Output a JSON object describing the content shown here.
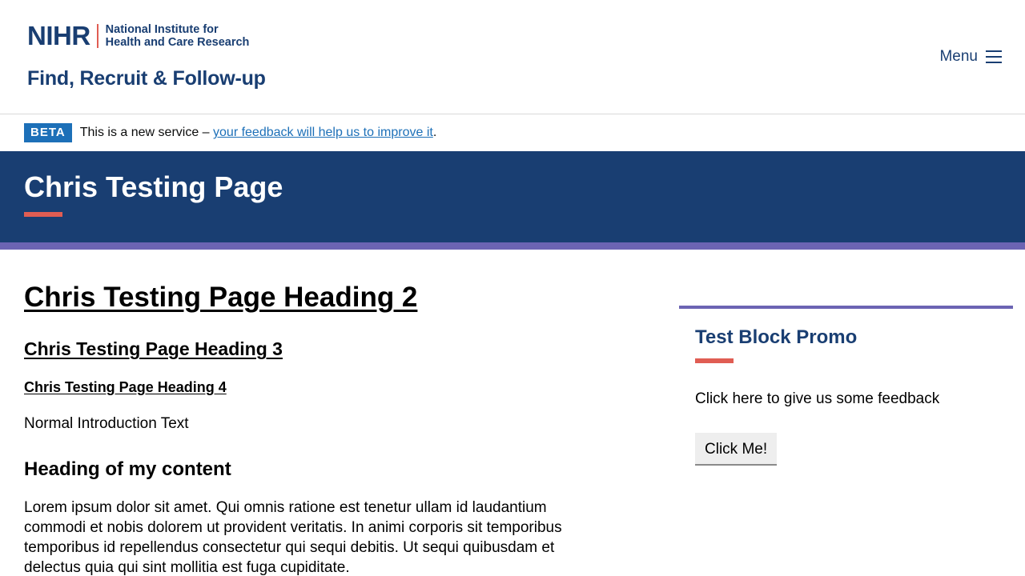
{
  "header": {
    "logo_mark": "NIHR",
    "logo_line1": "National Institute for",
    "logo_line2": "Health and Care Research",
    "service_name": "Find, Recruit & Follow-up",
    "menu_label": "Menu",
    "menu_icon": "hamburger-icon"
  },
  "beta": {
    "tag": "BETA",
    "text_before": "This is a new service – ",
    "link_text": "your feedback will help us to improve it",
    "text_after": "."
  },
  "title_band": {
    "title": "Chris Testing Page"
  },
  "main": {
    "heading2": "Chris Testing Page Heading 2",
    "heading3": "Chris Testing Page Heading 3",
    "heading4": "Chris Testing Page Heading 4",
    "intro": "Normal Introduction Text",
    "content_heading": "Heading of my content",
    "body": "Lorem ipsum dolor sit amet. Qui omnis ratione est tenetur ullam id laudantium commodi et nobis dolorem ut provident veritatis. In animi corporis sit temporibus temporibus id repellendus consectetur qui sequi debitis. Ut sequi quibusdam et delectus quia qui sint mollitia est fuga cupiditate."
  },
  "promo": {
    "title": "Test Block Promo",
    "text": "Click here to give us some feedback",
    "button_label": "Click Me!"
  },
  "colors": {
    "brand_navy": "#193e72",
    "accent_coral": "#e05d53",
    "accent_purple": "#6c64b3",
    "link_blue": "#1d70b8"
  }
}
